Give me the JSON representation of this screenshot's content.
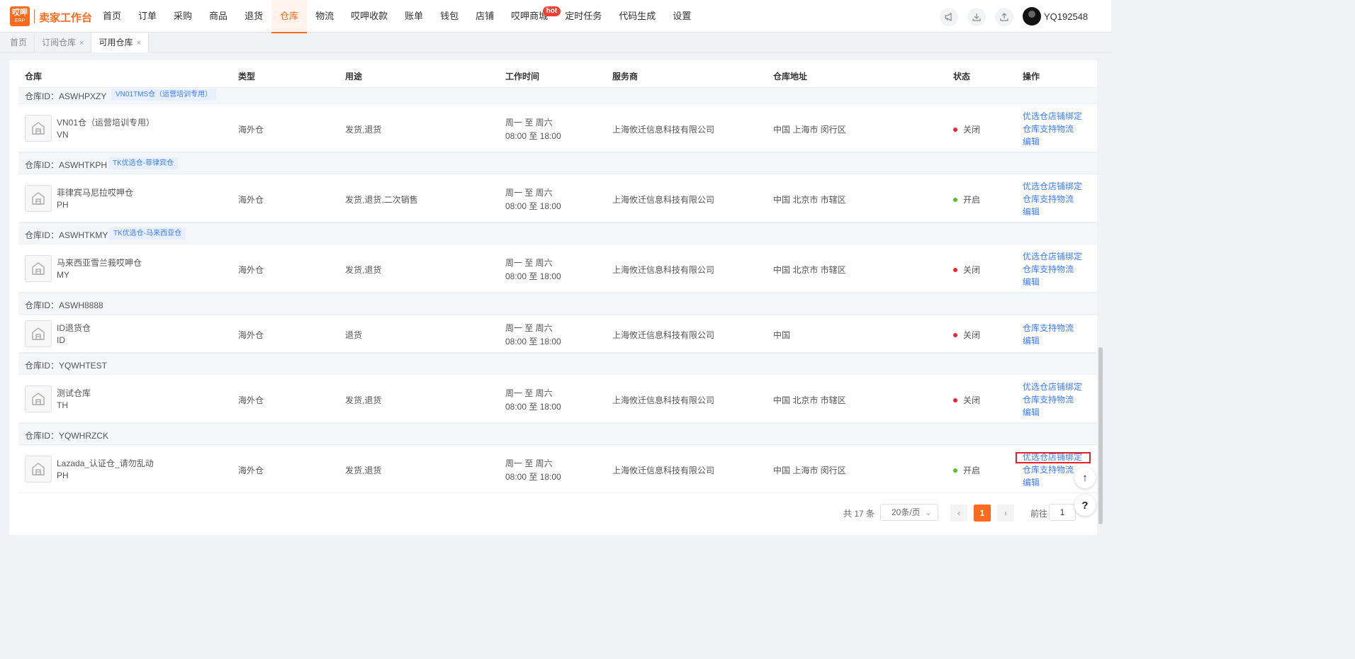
{
  "app": {
    "logo_text": "哎呷",
    "logo_sub": "ERP",
    "brand": "卖家工作台"
  },
  "nav": [
    {
      "label": "首页"
    },
    {
      "label": "订单"
    },
    {
      "label": "采购"
    },
    {
      "label": "商品"
    },
    {
      "label": "退货"
    },
    {
      "label": "仓库",
      "active": true
    },
    {
      "label": "物流"
    },
    {
      "label": "哎呷收款"
    },
    {
      "label": "账单"
    },
    {
      "label": "钱包"
    },
    {
      "label": "店铺"
    },
    {
      "label": "哎呷商城",
      "badge": "hot"
    },
    {
      "label": "定时任务"
    },
    {
      "label": "代码生成"
    },
    {
      "label": "设置"
    }
  ],
  "user": {
    "name": "YQ192548"
  },
  "tabs": [
    {
      "label": "首页"
    },
    {
      "label": "订阅仓库",
      "close": "×"
    },
    {
      "label": "可用仓库",
      "close": "×",
      "active": true
    }
  ],
  "table": {
    "headers": {
      "warehouse": "仓库",
      "type": "类型",
      "usage": "用途",
      "hours": "工作时间",
      "provider": "服务商",
      "address": "仓库地址",
      "status": "状态",
      "actions": "操作"
    },
    "groups": [
      {
        "id_label": "仓库ID：ASWHPXZY",
        "tag": "VN01TMS仓（运营培训专用）",
        "row": {
          "name": "VN01仓（运营培训专用）",
          "code": "VN",
          "type": "海外仓",
          "usage": "发货,退货",
          "hours1": "周一 至 周六",
          "hours2": "08:00 至 18:00",
          "provider": "上海攸迁信息科技有限公司",
          "address": "中国 上海市 闵行区",
          "status": "关闭",
          "status_color": "#f5222d",
          "actions": [
            "优选仓店铺绑定",
            "仓库支持物流",
            "编辑"
          ]
        }
      },
      {
        "id_label": "仓库ID：ASWHTKPH",
        "tag": "TK优选仓-菲律宾仓",
        "row": {
          "name": "菲律宾马尼拉哎呷仓",
          "code": "PH",
          "type": "海外仓",
          "usage": "发货,退货,二次销售",
          "hours1": "周一 至 周六",
          "hours2": "08:00 至 18:00",
          "provider": "上海攸迁信息科技有限公司",
          "address": "中国 北京市 市辖区",
          "status": "开启",
          "status_color": "#52c41a",
          "actions": [
            "优选仓店铺绑定",
            "仓库支持物流",
            "编辑"
          ]
        }
      },
      {
        "id_label": "仓库ID：ASWHTKMY",
        "tag": "TK优选仓-马来西亚仓",
        "row": {
          "name": "马来西亚雪兰莪哎呷仓",
          "code": "MY",
          "type": "海外仓",
          "usage": "发货,退货",
          "hours1": "周一 至 周六",
          "hours2": "08:00 至 18:00",
          "provider": "上海攸迁信息科技有限公司",
          "address": "中国 北京市 市辖区",
          "status": "关闭",
          "status_color": "#f5222d",
          "actions": [
            "优选仓店铺绑定",
            "仓库支持物流",
            "编辑"
          ]
        }
      },
      {
        "id_label": "仓库ID：ASWH8888",
        "tag": "",
        "row": {
          "name": "ID退货仓",
          "code": "ID",
          "type": "海外仓",
          "usage": "退货",
          "hours1": "周一 至 周六",
          "hours2": "08:00 至 18:00",
          "provider": "上海攸迁信息科技有限公司",
          "address": "中国",
          "status": "关闭",
          "status_color": "#f5222d",
          "actions": [
            "仓库支持物流",
            "编辑"
          ]
        }
      },
      {
        "id_label": "仓库ID：YQWHTEST",
        "tag": "",
        "row": {
          "name": "测试仓库",
          "code": "TH",
          "type": "海外仓",
          "usage": "发货,退货",
          "hours1": "周一 至 周六",
          "hours2": "08:00 至 18:00",
          "provider": "上海攸迁信息科技有限公司",
          "address": "中国 北京市 市辖区",
          "status": "关闭",
          "status_color": "#f5222d",
          "actions": [
            "优选仓店铺绑定",
            "仓库支持物流",
            "编辑"
          ]
        }
      },
      {
        "id_label": "仓库ID：YQWHRZCK",
        "tag": "",
        "row": {
          "name": "Lazada_认证仓_请勿乱动",
          "code": "PH",
          "type": "海外仓",
          "usage": "发货,退货",
          "hours1": "周一 至 周六",
          "hours2": "08:00 至 18:00",
          "provider": "上海攸迁信息科技有限公司",
          "address": "中国 上海市 闵行区",
          "status": "开启",
          "status_color": "#52c41a",
          "actions": [
            "优选仓店铺绑定",
            "仓库支持物流",
            "编辑"
          ]
        }
      }
    ]
  },
  "pagination": {
    "total": "共 17 条",
    "page_size": "20条/页",
    "prev": "‹",
    "current": "1",
    "next": "›",
    "goto_label": "前往",
    "goto_value": "1"
  },
  "float": {
    "top": "↑",
    "help": "?"
  },
  "colors": {
    "accent": "#fb6b1d",
    "link": "#3b7cff"
  }
}
